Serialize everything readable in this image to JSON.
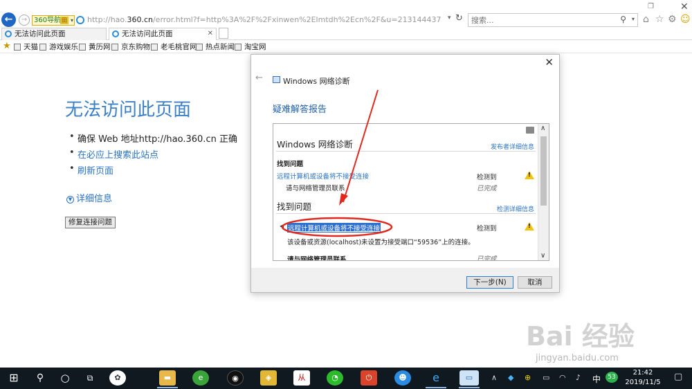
{
  "browser": {
    "nav_badge": "360导航",
    "url_prefix": "http://hao.",
    "url_domain": "360.cn",
    "url_rest": "/error.html?f=http%3A%2F%2Fxinwen%2Elmtdh%2Ecn%2F&u=213144437",
    "search_placeholder": "搜索...",
    "tabs": [
      {
        "label": "无法访问此页面"
      },
      {
        "label": "无法访问此页面"
      }
    ],
    "favorites": [
      {
        "label": "天猫"
      },
      {
        "label": "游戏娱乐"
      },
      {
        "label": "黄历网"
      },
      {
        "label": "京东购物"
      },
      {
        "label": "老毛桃官网"
      },
      {
        "label": "热点新闻"
      },
      {
        "label": "淘宝网"
      }
    ]
  },
  "error_page": {
    "title": "无法访问此页面",
    "bullets": [
      "确保 Web 地址http://hao.360.cn 正确",
      "在必应上搜索此站点",
      "刷新页面"
    ],
    "details_label": "详细信息",
    "fix_button": "修复连接问题"
  },
  "dialog": {
    "app_title": "Windows 网络诊断",
    "heading": "疑难解答报告",
    "report": {
      "title": "Windows 网络诊断",
      "publisher_link": "发布者详细信息",
      "found_label": "找到问题",
      "issue_link": "远程计算机或设备将不接受连接",
      "detected_label": "检测到",
      "contact_text": "请与网络管理员联系",
      "completed_text": "已完成",
      "section2_title": "找到问题",
      "detect_details_link": "检测详细信息",
      "issue_highlight": "远程计算机或设备将不接受连接",
      "detected_label2": "检测到",
      "issue_desc": "该设备或资源(localhost)未设置为接受端口“59536”上的连接。",
      "contact_text2": "请与网络管理员联系",
      "completed_text2": "已完成"
    },
    "next_button": "下一步(N)",
    "cancel_button": "取消"
  },
  "watermark": {
    "brand": "Bai 经验",
    "url": "jingyan.baidu.com"
  },
  "taskbar": {
    "time": "21:42",
    "date": "2019/11/5",
    "ime": "中",
    "badge": "53"
  },
  "colors": {
    "link": "#2a72c4",
    "title_blue": "#3b7fc9",
    "highlight": "#2d6fd0",
    "annotation_red": "#e0281f"
  }
}
